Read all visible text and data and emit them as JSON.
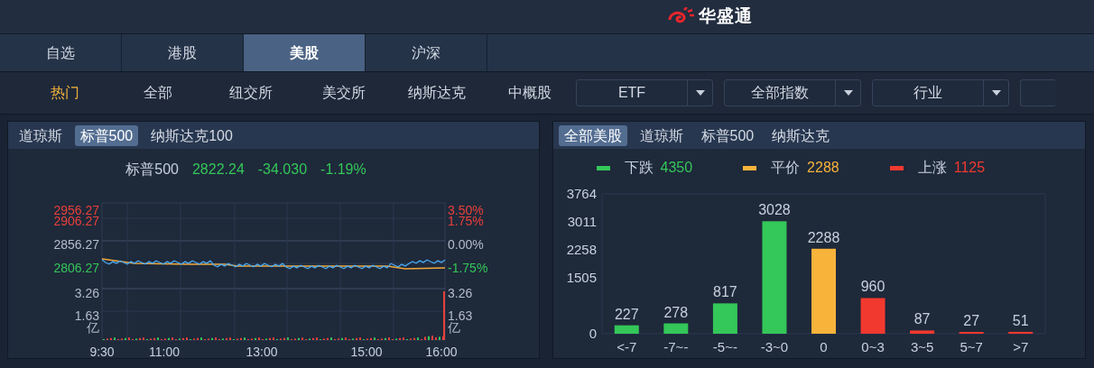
{
  "header": {
    "logo_text": "华盛通"
  },
  "market_tabs": [
    {
      "label": "自选",
      "selected": false
    },
    {
      "label": "港股",
      "selected": false
    },
    {
      "label": "美股",
      "selected": true
    },
    {
      "label": "沪深",
      "selected": false
    }
  ],
  "categories": [
    {
      "label": "热门",
      "selected": true
    },
    {
      "label": "全部",
      "selected": false
    },
    {
      "label": "纽交所",
      "selected": false
    },
    {
      "label": "美交所",
      "selected": false
    },
    {
      "label": "纳斯达克",
      "selected": false
    },
    {
      "label": "中概股",
      "selected": false
    }
  ],
  "dropdowns": [
    {
      "label": "ETF"
    },
    {
      "label": "全部指数"
    },
    {
      "label": "行业"
    }
  ],
  "index_panel": {
    "tabs": [
      {
        "label": "道琼斯",
        "selected": false
      },
      {
        "label": "标普500",
        "selected": true
      },
      {
        "label": "纳斯达克100",
        "selected": false
      }
    ],
    "quote": {
      "name": "标普500",
      "price": "2822.24",
      "change": "-34.030",
      "change_pct": "-1.19%"
    },
    "left_axis": [
      {
        "label": "2956.27",
        "color": "#e8403a"
      },
      {
        "label": "2906.27",
        "color": "#e8403a"
      },
      {
        "label": "2856.27",
        "color": "#b4bdc9"
      },
      {
        "label": "2806.27",
        "color": "#34c759"
      },
      {
        "label": "3.26",
        "color": "#b4bdc9"
      },
      {
        "label": "1.63",
        "color": "#b4bdc9"
      },
      {
        "label": "亿",
        "color": "#b4bdc9"
      }
    ],
    "right_axis": [
      {
        "label": "3.50%",
        "color": "#e8403a"
      },
      {
        "label": "1.75%",
        "color": "#e8403a"
      },
      {
        "label": "0.00%",
        "color": "#b4bdc9"
      },
      {
        "label": "-1.75%",
        "color": "#34c759"
      },
      {
        "label": "3.26",
        "color": "#b4bdc9"
      },
      {
        "label": "1.63",
        "color": "#b4bdc9"
      },
      {
        "label": "亿",
        "color": "#b4bdc9"
      }
    ],
    "time_axis": [
      "9:30",
      "11:00",
      "13:00",
      "15:00",
      "16:00"
    ]
  },
  "breadth_panel": {
    "tabs": [
      {
        "label": "全部美股",
        "selected": true
      },
      {
        "label": "道琼斯",
        "selected": false
      },
      {
        "label": "标普500",
        "selected": false
      },
      {
        "label": "纳斯达克",
        "selected": false
      }
    ],
    "legend": [
      {
        "label": "下跌",
        "count": "4350",
        "color": "#34c759"
      },
      {
        "label": "平价",
        "count": "2288",
        "color": "#f8b33b"
      },
      {
        "label": "上涨",
        "count": "1125",
        "color": "#f2392f"
      }
    ],
    "chart_data": {
      "type": "bar",
      "categories": [
        "<-7",
        "-7~-",
        "-5~-",
        "-3~0",
        "0",
        "0~3",
        "3~5",
        "5~7",
        ">7"
      ],
      "series": [
        {
          "color": "#34c759",
          "values": [
            227,
            278,
            817,
            3028,
            null,
            null,
            null,
            null,
            null
          ]
        },
        {
          "color": "#f8b33b",
          "values": [
            null,
            null,
            null,
            null,
            2288,
            null,
            null,
            null,
            null
          ]
        },
        {
          "color": "#f2392f",
          "values": [
            null,
            null,
            null,
            null,
            null,
            960,
            87,
            27,
            51
          ]
        }
      ],
      "ylim": [
        0,
        3764
      ],
      "yticks": [
        0,
        1505,
        2258,
        3011,
        3764
      ],
      "data_labels": true
    }
  }
}
